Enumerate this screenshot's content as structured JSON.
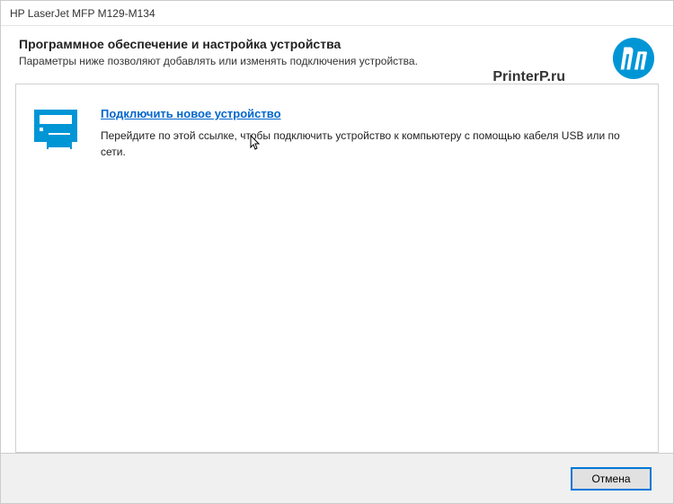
{
  "titlebar": {
    "title": "HP LaserJet MFP M129-M134"
  },
  "header": {
    "title": "Программное обеспечение и настройка устройства",
    "subtitle": "Параметры ниже позволяют добавлять или изменять подключения устройства."
  },
  "watermark": "PrinterP.ru",
  "content": {
    "connect_link": "Подключить новое устройство",
    "connect_description": "Перейдите по этой ссылке, чтобы подключить устройство к компьютеру с помощью кабеля USB или по сети."
  },
  "footer": {
    "cancel_label": "Отмена"
  },
  "colors": {
    "hp_blue": "#0096d6",
    "link_blue": "#0066cc"
  }
}
